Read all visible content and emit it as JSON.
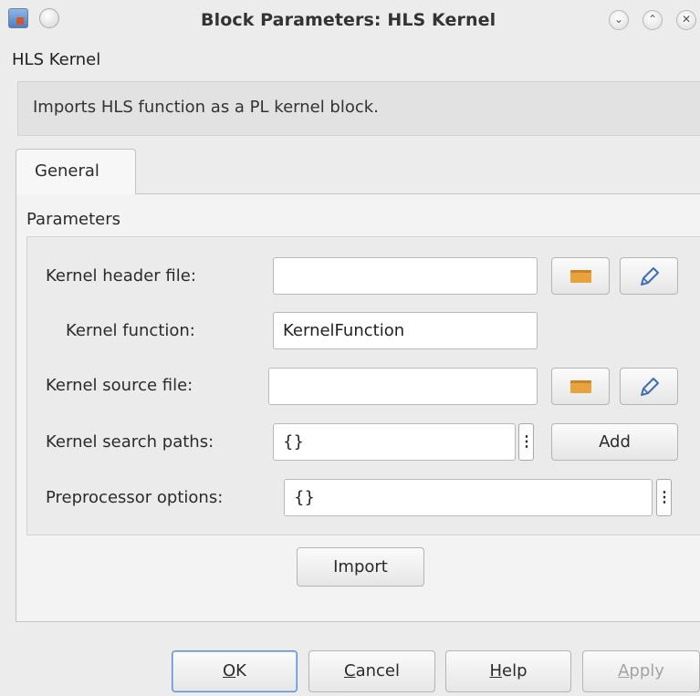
{
  "window": {
    "title": "Block Parameters: HLS Kernel",
    "controls": {
      "minimize": "⌄",
      "maximize": "⌃",
      "close": "✕"
    }
  },
  "block": {
    "name": "HLS Kernel",
    "description": "Imports HLS function as a PL kernel block."
  },
  "tabs": [
    {
      "label": "General",
      "active": true
    }
  ],
  "parameters": {
    "group_label": "Parameters",
    "header_file": {
      "label": "Kernel header file:",
      "value": ""
    },
    "function": {
      "label": "Kernel function:",
      "value": "KernelFunction"
    },
    "source_file": {
      "label": "Kernel source file:",
      "value": ""
    },
    "search_paths": {
      "label": "Kernel search paths:",
      "value": "{}",
      "add_label": "Add"
    },
    "preprocessor": {
      "label": "Preprocessor options:",
      "value": "{}"
    },
    "kebab_glyph": "⋮",
    "import_label": "Import"
  },
  "icons": {
    "browse": "folder-icon",
    "edit": "pencil-icon"
  },
  "footer": {
    "ok": {
      "key": "O",
      "rest": "K"
    },
    "cancel": {
      "key": "C",
      "rest": "ancel"
    },
    "help": {
      "key": "H",
      "rest": "elp"
    },
    "apply": {
      "key": "A",
      "rest": "pply",
      "enabled": false
    }
  },
  "colors": {
    "background": "#ececec",
    "panel": "#f3f3f3",
    "accent": "#5c8fd0",
    "folder": "#e8a33c",
    "pencil": "#3f6fae"
  }
}
